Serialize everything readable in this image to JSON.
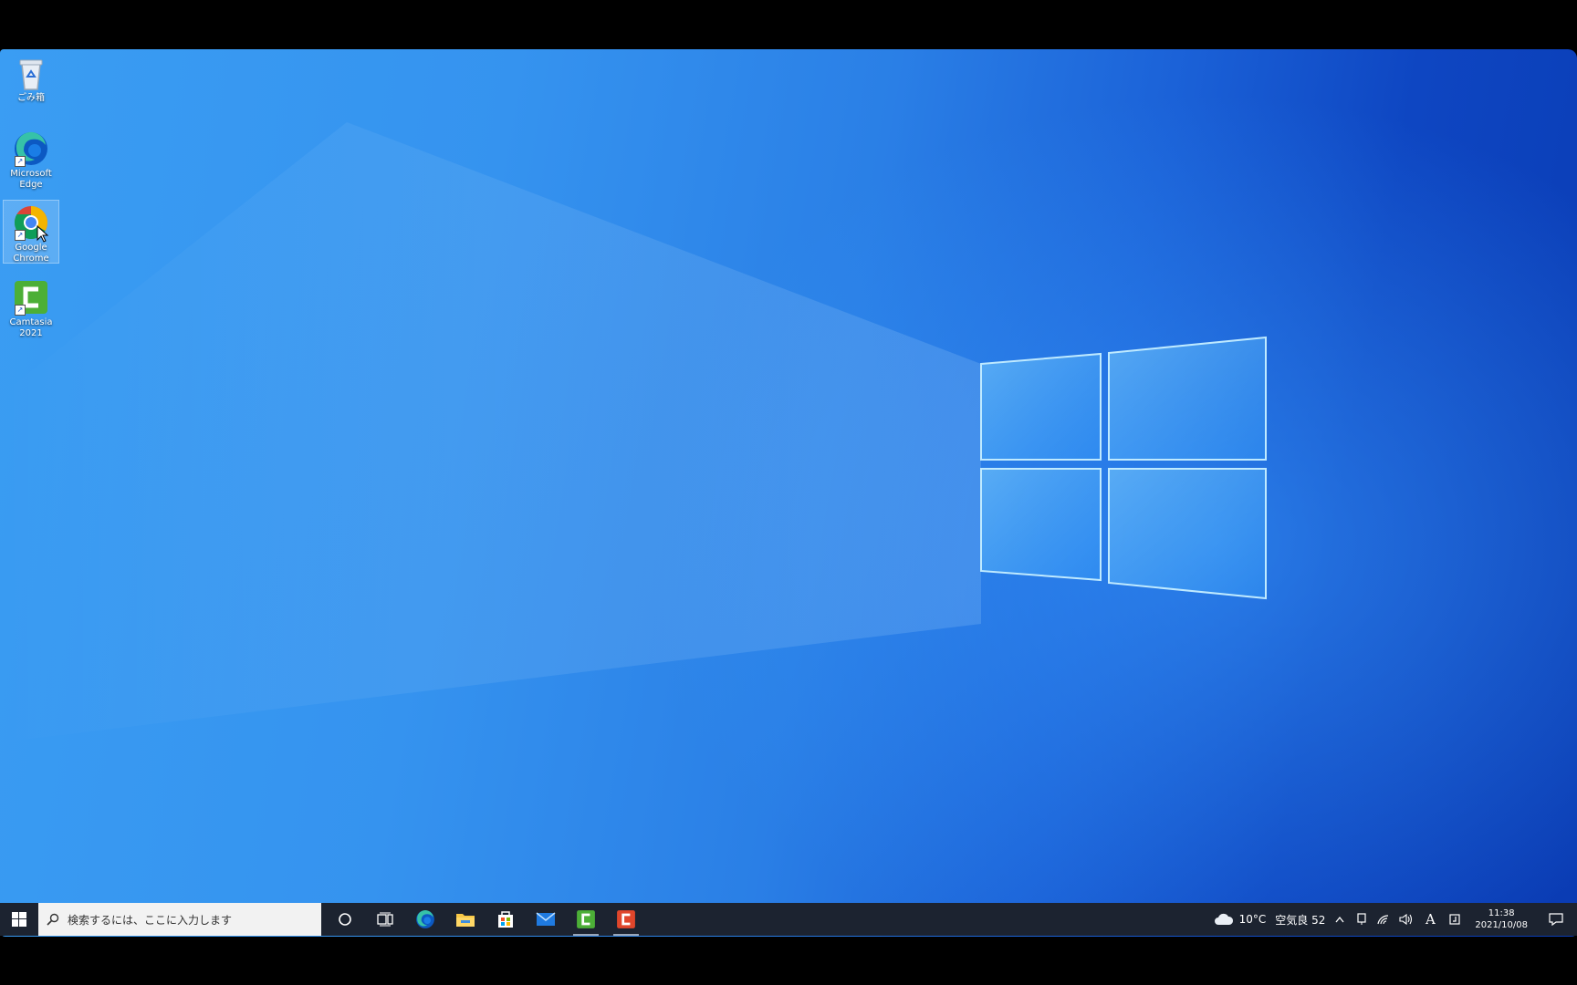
{
  "desktop": {
    "icons": [
      {
        "label_line1": "ごみ箱",
        "label_line2": "",
        "icon": "recycle-bin-icon"
      },
      {
        "label_line1": "Microsoft",
        "label_line2": "Edge",
        "icon": "edge-icon"
      },
      {
        "label_line1": "Google",
        "label_line2": "Chrome",
        "icon": "chrome-icon"
      },
      {
        "label_line1": "Camtasia",
        "label_line2": "2021",
        "icon": "camtasia-icon"
      }
    ]
  },
  "taskbar": {
    "search_placeholder": "検索するには、ここに入力します",
    "pinned": [
      "cortana-icon",
      "task-view-icon",
      "edge-icon",
      "file-explorer-icon",
      "store-icon",
      "mail-icon",
      "camtasia-icon",
      "camtasia-recorder-icon"
    ],
    "weather": {
      "temperature": "10°C",
      "air_quality": "空気良 52"
    },
    "ime": "A",
    "clock": {
      "time": "11:38",
      "date": "2021/10/08"
    }
  },
  "colors": {
    "taskbar": "#1c2330",
    "accent": "#0a3bb3",
    "wallpaper_light": "#3a9df3"
  }
}
